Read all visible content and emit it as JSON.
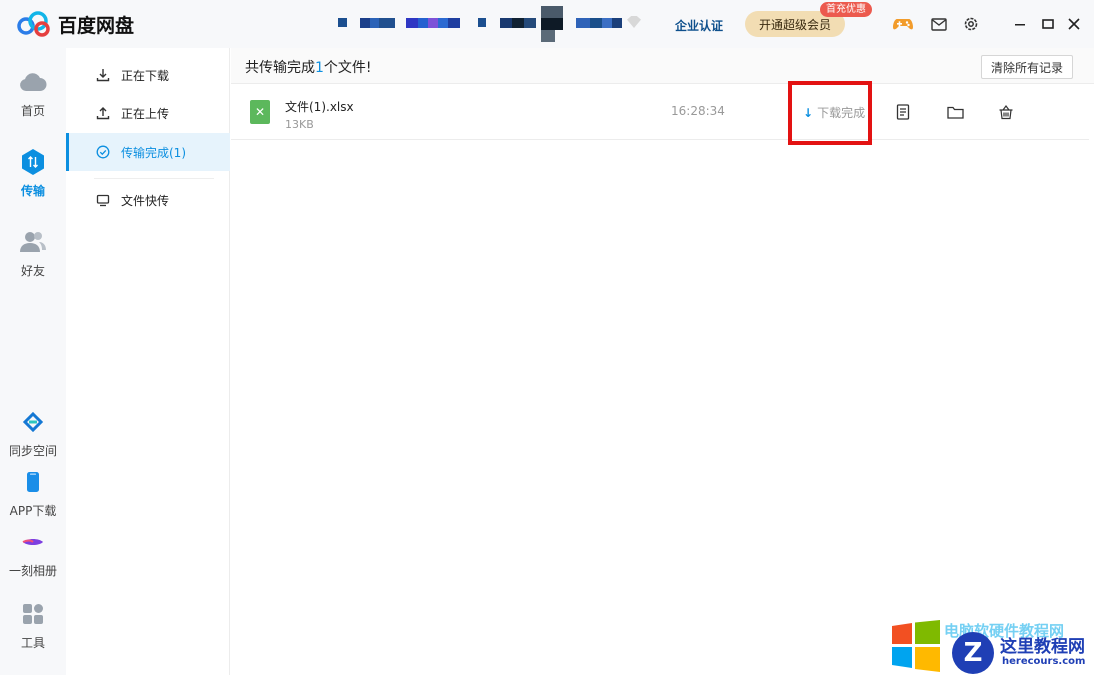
{
  "app": {
    "name": "百度网盘"
  },
  "header": {
    "enterprise_label": "企业认证",
    "vip_label": "开通超级会员",
    "vip_badge": "首充优惠",
    "icons": [
      "game-icon",
      "mail-icon",
      "settings-icon",
      "minimize-icon",
      "maximize-icon",
      "close-icon"
    ]
  },
  "leftnav": {
    "items": [
      {
        "label": "首页",
        "icon": "cloud-icon"
      },
      {
        "label": "传输",
        "icon": "transfer-icon",
        "active": true
      },
      {
        "label": "好友",
        "icon": "friends-icon"
      },
      {
        "label": "同步空间",
        "icon": "sync-icon"
      },
      {
        "label": "APP下载",
        "icon": "phone-icon"
      },
      {
        "label": "一刻相册",
        "icon": "album-icon"
      },
      {
        "label": "工具",
        "icon": "tools-icon"
      }
    ]
  },
  "subnav": {
    "items": [
      {
        "label": "正在下载",
        "icon": "download-icon"
      },
      {
        "label": "正在上传",
        "icon": "upload-icon"
      },
      {
        "label": "传输完成(1)",
        "icon": "check-circle-icon",
        "active": true
      },
      {
        "label": "文件快传",
        "icon": "monitor-icon"
      }
    ]
  },
  "main": {
    "summary_prefix": "共传输完成",
    "summary_count": "1",
    "summary_suffix": "个文件!",
    "clear_label": "清除所有记录",
    "files": [
      {
        "name": "文件(1).xlsx",
        "size": "13KB",
        "time": "16:28:34",
        "status": "下载完成",
        "type_icon": "excel-file-icon"
      }
    ],
    "row_actions": [
      "document-icon",
      "folder-icon",
      "delete-basket-icon"
    ]
  },
  "watermark": {
    "brand": "这里教程网",
    "url": "herecours.com",
    "overlay": "电脑软硬件教程网"
  },
  "colors": {
    "accent": "#0c8fe0",
    "highlight": "#e31212",
    "vip_bg": "#f2ddb3",
    "badge": "#ec5a4e"
  }
}
